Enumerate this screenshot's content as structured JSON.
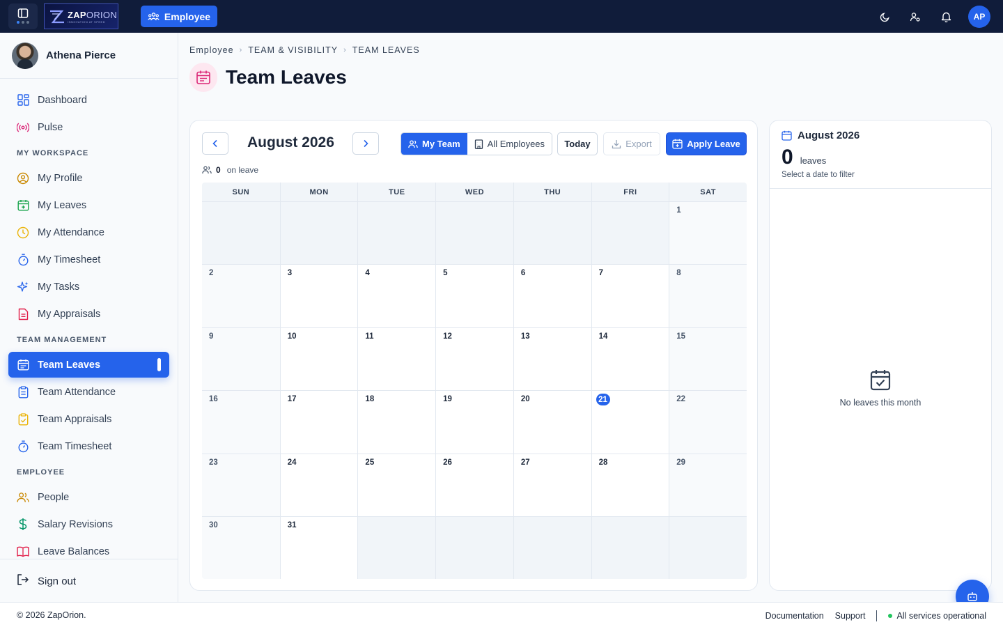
{
  "header": {
    "logo_name": "ZAP",
    "logo_name_2": "ORION",
    "logo_tagline": "INNOVATION AT SPEED",
    "mode_label": "Employee",
    "avatar_initials": "AP"
  },
  "user": {
    "name": "Athena Pierce"
  },
  "sidebar": {
    "items_top": [
      {
        "label": "Dashboard",
        "icon": "grid-icon"
      },
      {
        "label": "Pulse",
        "icon": "broadcast-icon"
      }
    ],
    "sections": [
      {
        "title": "MY WORKSPACE",
        "items": [
          {
            "label": "My Profile",
            "icon": "user-circle-icon"
          },
          {
            "label": "My Leaves",
            "icon": "calendar-plus-icon"
          },
          {
            "label": "My Attendance",
            "icon": "clock-icon"
          },
          {
            "label": "My Timesheet",
            "icon": "stopwatch-icon"
          },
          {
            "label": "My Tasks",
            "icon": "sparkle-icon"
          },
          {
            "label": "My Appraisals",
            "icon": "document-icon"
          }
        ]
      },
      {
        "title": "TEAM MANAGEMENT",
        "items": [
          {
            "label": "Team Leaves",
            "icon": "calendar-icon",
            "active": true
          },
          {
            "label": "Team Attendance",
            "icon": "clipboard-icon"
          },
          {
            "label": "Team Appraisals",
            "icon": "clipboard-check-icon"
          },
          {
            "label": "Team Timesheet",
            "icon": "stopwatch-icon"
          }
        ]
      },
      {
        "title": "EMPLOYEE",
        "items": [
          {
            "label": "People",
            "icon": "users-icon"
          },
          {
            "label": "Salary Revisions",
            "icon": "dollar-icon"
          },
          {
            "label": "Leave Balances",
            "icon": "book-icon"
          }
        ]
      }
    ],
    "signout_label": "Sign out"
  },
  "breadcrumb": [
    "Employee",
    "TEAM & VISIBILITY",
    "TEAM LEAVES"
  ],
  "page_title": "Team Leaves",
  "calendar": {
    "month_label": "August 2026",
    "toggle": {
      "my_team": "My Team",
      "all_employees": "All Employees"
    },
    "today_label": "Today",
    "export_label": "Export",
    "apply_label": "Apply Leave",
    "on_leave_count": "0",
    "on_leave_text": "on leave",
    "weekdays": [
      "SUN",
      "MON",
      "TUE",
      "WED",
      "THU",
      "FRI",
      "SAT"
    ],
    "first_weekday_index": 6,
    "days_in_month": 31,
    "today_day": 21
  },
  "summary": {
    "month_label": "August 2026",
    "count": "0",
    "count_label": "leaves",
    "hint": "Select a date to filter",
    "empty_text": "No leaves this month"
  },
  "footer": {
    "copyright": "© 2026 ZapOrion.",
    "documentation": "Documentation",
    "support": "Support",
    "status": "All services operational"
  },
  "colors": {
    "primary": "#2563eb",
    "topbar": "#101c3a",
    "status_ok": "#22c55e"
  }
}
